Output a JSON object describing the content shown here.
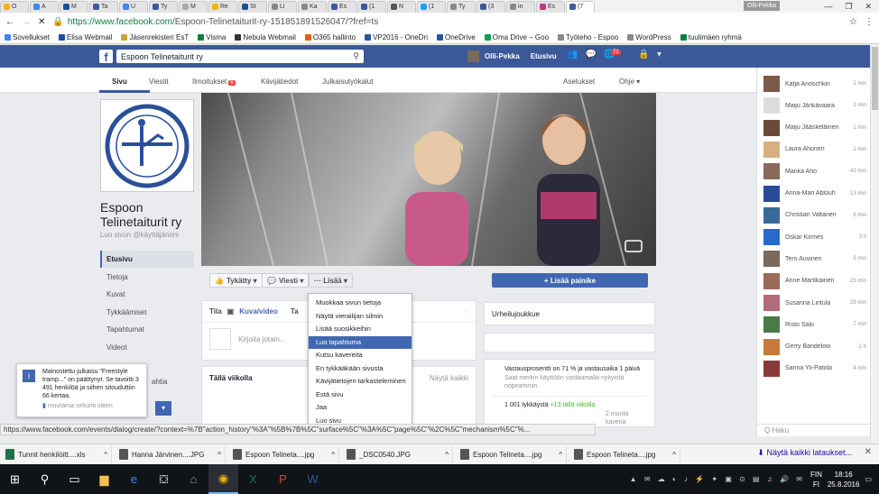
{
  "tabs": [
    "O",
    "A",
    "M",
    "Ta",
    "U",
    "Ty",
    "M",
    "Re",
    "St",
    "Li",
    "Ka",
    "Es",
    "(1",
    "N",
    "(1",
    "Ty",
    "(3",
    "in",
    "Es",
    "(7"
  ],
  "user_chip": "Olli-Pekka",
  "window_controls": {
    "minimize": "—",
    "restore": "❐",
    "close": "✕"
  },
  "address": {
    "host": "https://www.facebook.com",
    "path": "/Espoon-Telinetaiturit-ry-151851891526047/?fref=ts"
  },
  "bookmarks": [
    {
      "label": "Sovellukset",
      "color": "#4285f4"
    },
    {
      "label": "Elisa Webmail",
      "color": "#1b4f9c"
    },
    {
      "label": "Jäsenrekisteri EsT",
      "color": "#c8a040"
    },
    {
      "label": "Visma",
      "color": "#0b8043"
    },
    {
      "label": "Nebula Webmail",
      "color": "#333"
    },
    {
      "label": "O365 hallinto",
      "color": "#e8590c"
    },
    {
      "label": "VP2016 - OneDri",
      "color": "#2b579a"
    },
    {
      "label": "OneDrive",
      "color": "#2b579a"
    },
    {
      "label": "Oma Drive – Goo",
      "color": "#0f9d58"
    },
    {
      "label": "Työteho - Espoo",
      "color": "#888"
    },
    {
      "label": "WordPress",
      "color": "#888"
    },
    {
      "label": "tuulimäen ryhmä",
      "color": "#0b8043"
    }
  ],
  "fb": {
    "search_value": "Espoon Telinetaiturit ry",
    "user_name": "Olli-Pekka",
    "home_label": "Etusivu",
    "notif_count": "72"
  },
  "page_nav": {
    "sivu": "Sivu",
    "viestit": "Viestit",
    "ilmoitukset": "Ilmoitukset",
    "ilm_badge": "6",
    "kavijatiedot": "Kävijätiedot",
    "julkaisutyokalut": "Julkaisutyökalut",
    "asetukset": "Asetukset",
    "ohje": "Ohje ▾"
  },
  "page": {
    "name": "Espoon Telinetaiturit ry",
    "username_hint": "Luo sivun @käyttäjänimi"
  },
  "left_nav": [
    "Etusivu",
    "Tietoja",
    "Kuvat",
    "Tykkäämiset",
    "Tapahtumat",
    "Videot"
  ],
  "left_nav_extra": "ahtia",
  "actions": {
    "like": "Tykätty ▾",
    "message": "Viesti ▾",
    "more": "··· Lisää ▾",
    "add_button": "+  Lisää painike"
  },
  "dropdown": [
    "Muokkaa sivun tietoja",
    "Näytä vierailijan silmin",
    "Lisää suosikkeihin",
    "Luo tapahtuma",
    "Kutsu kavereita",
    "En tykkääkään sivusta",
    "Kävijätietojen tarkasteleminen",
    "Estä sivu",
    "Jaa",
    "Luo sivu"
  ],
  "dropdown_highlight": "Luo tapahtuma",
  "composer": {
    "tila": "Tila",
    "photo_video": "Kuva/video",
    "tab3": "Ta",
    "placeholder": "Kirjoita jotain..."
  },
  "this_week": {
    "title": "Tällä viikolla",
    "show_all": "Näytä kaikki"
  },
  "right_col": {
    "category": "Urheilujoukkue",
    "response": "Vastausprosentti on 71 % ja vastausaika 1 päivä",
    "response_hint": "Saat merkin käyttöön vastaamalla nykyistä nopeammin.",
    "likes": "1 001 tykkäystä",
    "likes_week": "+13 tällä viikolla",
    "friends": "2 muuta kaveria"
  },
  "chat": [
    {
      "name": "Katja Anoschkin",
      "time": "1 min",
      "color": "#7c5a4a"
    },
    {
      "name": "Maiju Jänkävaara",
      "time": "1 min",
      "color": "#ddd"
    },
    {
      "name": "Maiju Jääskeläinen",
      "time": "1 min",
      "color": "#6b4a3a"
    },
    {
      "name": "Laura Ahonen",
      "time": "1 min",
      "color": "#d8b080"
    },
    {
      "name": "Marika Aho",
      "time": "43 min",
      "color": "#8a6a5a"
    },
    {
      "name": "Anna-Mari Ablouh",
      "time": "13 min",
      "color": "#2a4a9a"
    },
    {
      "name": "Christian Valtanen",
      "time": "6 min",
      "color": "#3a6a9a"
    },
    {
      "name": "Oskar Kirmes",
      "time": "3 h",
      "color": "#2a6acd"
    },
    {
      "name": "Tero Auvinen",
      "time": "5 min",
      "color": "#7a6a5a"
    },
    {
      "name": "Anne Martikainen",
      "time": "23 min",
      "color": "#9a6a5a"
    },
    {
      "name": "Susanna Lintula",
      "time": "29 min",
      "color": "#b46a7a"
    },
    {
      "name": "Risto Salo",
      "time": "7 min",
      "color": "#4a7a4a"
    },
    {
      "name": "Gerry Bandelow",
      "time": "2 h",
      "color": "#c87a3a"
    },
    {
      "name": "Sanna Yli-Patola",
      "time": "4 min",
      "color": "#8a3a3a"
    }
  ],
  "chat_search": "Q Haku",
  "ad_popup": {
    "text": "Mainostettu julkaisu \"Freestyle tramp...\" on päättynyt. Se tavoitti 3 491 henkilöä ja siihen sitouduttiin 66 kertaa.",
    "time": "muutama sekunti sitten"
  },
  "status_url": "https://www.facebook.com/events/dialog/create/?context=%7B\"action_history\"%3A\"%5B%7B%5C\"surface%5C\"%3A%5C\"page%5C\"%2C%5C\"mechanism%5C\"%...",
  "downloads": [
    {
      "name": "Tunnit henkilöitt....xls",
      "color": "#1e7145"
    },
    {
      "name": "Hanna Järvinen....JPG",
      "color": "#555"
    },
    {
      "name": "Espoon Telineta....jpg",
      "color": "#555"
    },
    {
      "name": "_DSC0540.JPG",
      "color": "#555"
    },
    {
      "name": "Espoon Telineta....jpg",
      "color": "#555"
    },
    {
      "name": "Espoon Telineta....jpg",
      "color": "#555"
    }
  ],
  "downloads_all": "⬇ Näytä kaikki lataukset...",
  "tray": {
    "lang": "FIN",
    "lang2": "FI",
    "time": "18:16",
    "date": "25.8.2016"
  }
}
